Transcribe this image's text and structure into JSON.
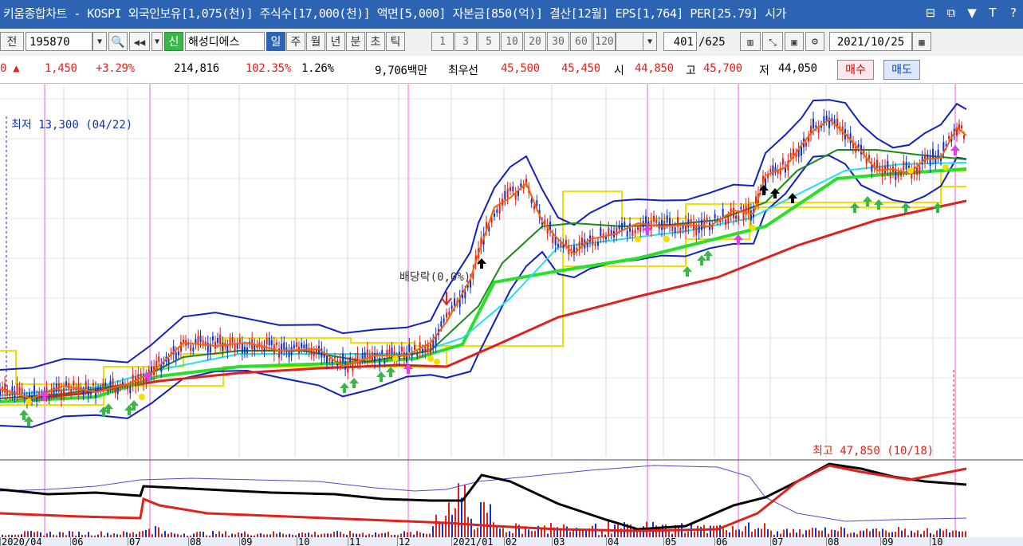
{
  "title": "키움종합차트 - KOSPI 외국인보유[1,075(천)] 주식수[17,000(천)] 액면[5,000] 자본금[850(억)] 결산[12월] EPS[1,764] PER[25.79] 시가",
  "window_icons": [
    "⊟",
    "⧉",
    "▼",
    "T",
    "?"
  ],
  "toolbar": {
    "prev_label": "전",
    "code": "195870",
    "new_label": "신",
    "name": "해성디에스",
    "periods": [
      "일",
      "주",
      "월",
      "년",
      "분",
      "초",
      "틱"
    ],
    "active_period": "일",
    "intervals": [
      "1",
      "3",
      "5",
      "10",
      "20",
      "30",
      "60",
      "120"
    ],
    "count": "401",
    "total": "/625",
    "date": "2021/10/25"
  },
  "quote": {
    "arrow": "0 ▲",
    "change": "1,450",
    "change_pct": "+3.29%",
    "volume": "214,816",
    "vol_ratio": "102.35%",
    "turnover": "1.26%",
    "amount": "9,706백만",
    "best_label": "최우선",
    "ask": "45,500",
    "bid": "45,450",
    "open_label": "시",
    "open": "44,850",
    "high_label": "고",
    "high": "45,700",
    "low_label": "저",
    "low": "44,050",
    "buy": "매수",
    "sell": "매도"
  },
  "chart": {
    "low_label": "최저 13,300 (04/22)",
    "high_label": "최고 47,850 (10/18)",
    "dividend_label": "배당락(0,0%)",
    "xaxis": [
      "2020/04",
      "06",
      "07",
      "08",
      "09",
      "10",
      "11",
      "12",
      "2021/01",
      "02",
      "03",
      "04",
      "05",
      "06",
      "07",
      "08",
      "09",
      "10"
    ],
    "colors": {
      "up": "#e0201b",
      "down": "#1030d0",
      "ma5": "#ff6000",
      "ma20": "#1a8a1a",
      "ma60": "#28e028",
      "ma120": "#e02020",
      "bb": "#1020c0",
      "env": "#f0e000",
      "cyan": "#20e0f0"
    }
  }
}
